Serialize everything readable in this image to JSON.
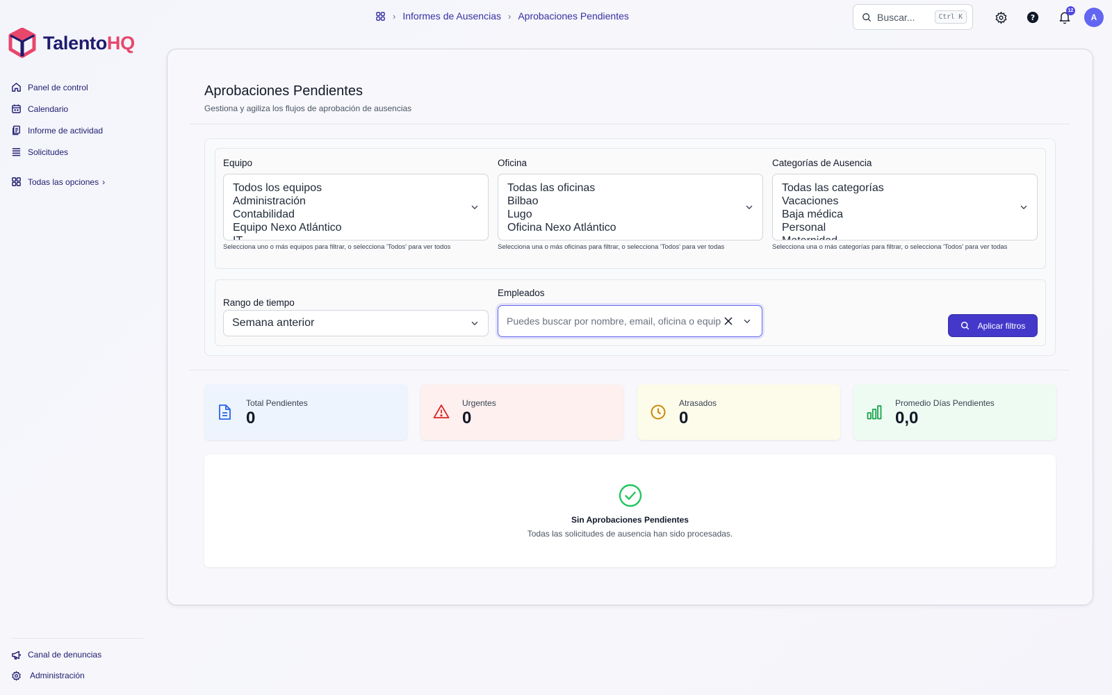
{
  "app": {
    "brand_main": "Talento",
    "brand_accent": "HQ",
    "brand_color": "#1e1b6e",
    "accent_color": "#e8466b"
  },
  "sidebar": {
    "items": [
      {
        "label": "Panel de control",
        "icon": "home-icon"
      },
      {
        "label": "Calendario",
        "icon": "calendar-icon"
      },
      {
        "label": "Informe de actividad",
        "icon": "report-icon"
      },
      {
        "label": "Solicitudes",
        "icon": "list-icon"
      },
      {
        "label": "Todas las opciones",
        "icon": "grid-icon"
      }
    ],
    "bottom": [
      {
        "label": "Canal de denuncias",
        "icon": "megaphone-icon"
      },
      {
        "label": "Administración",
        "icon": "gear-icon"
      }
    ]
  },
  "breadcrumb": {
    "items": [
      "Informes de Ausencias",
      "Aprobaciones Pendientes"
    ]
  },
  "topbar": {
    "search_placeholder": "Buscar...",
    "shortcut": "Ctrl K",
    "notifications_count": "12",
    "avatar_initial": "A"
  },
  "page": {
    "title": "Aprobaciones Pendientes",
    "subtitle": "Gestiona y agiliza los flujos de aprobación de ausencias"
  },
  "filters": {
    "team": {
      "label": "Equipo",
      "options": [
        "Todos los equipos",
        "Administración",
        "Contabilidad",
        "Equipo Nexo Atlántico",
        "IT"
      ],
      "helper": "Selecciona uno o más equipos para filtrar, o selecciona 'Todos' para ver todos"
    },
    "office": {
      "label": "Oficina",
      "options": [
        "Todas las oficinas",
        "Bilbao",
        "Lugo",
        "Oficina Nexo Atlántico"
      ],
      "helper": "Selecciona una o más oficinas para filtrar, o selecciona 'Todos' para ver todas"
    },
    "category": {
      "label": "Categorías de Ausencia",
      "options": [
        "Todas las categorías",
        "Vacaciones",
        "Baja médica",
        "Personal",
        "Maternidad"
      ],
      "helper": "Selecciona una o más categorías para filtrar, o selecciona 'Todos' para ver todas"
    },
    "time_range": {
      "label": "Rango de tiempo",
      "value": "Semana anterior"
    },
    "employees": {
      "label": "Empleados",
      "placeholder": "Puedes buscar por nombre, email, oficina o equipo"
    },
    "apply_label": "Aplicar filtros",
    "apply_color": "#4338ca"
  },
  "stats": [
    {
      "label": "Total Pendientes",
      "value": "0",
      "icon": "document-icon",
      "bg": "#eef4fd",
      "color": "#2563eb"
    },
    {
      "label": "Urgentes",
      "value": "0",
      "icon": "warning-icon",
      "bg": "#fdf0ef",
      "color": "#dc2626"
    },
    {
      "label": "Atrasados",
      "value": "0",
      "icon": "clock-icon",
      "bg": "#fdfbea",
      "color": "#ca8a04"
    },
    {
      "label": "Promedio Días Pendientes",
      "value": "0,0",
      "icon": "bar-chart-icon",
      "bg": "#eefbf2",
      "color": "#16a34a"
    }
  ],
  "empty_state": {
    "title": "Sin Aprobaciones Pendientes",
    "message": "Todas las solicitudes de ausencia han sido procesadas.",
    "icon": "check-circle-icon",
    "color": "#22c55e"
  }
}
